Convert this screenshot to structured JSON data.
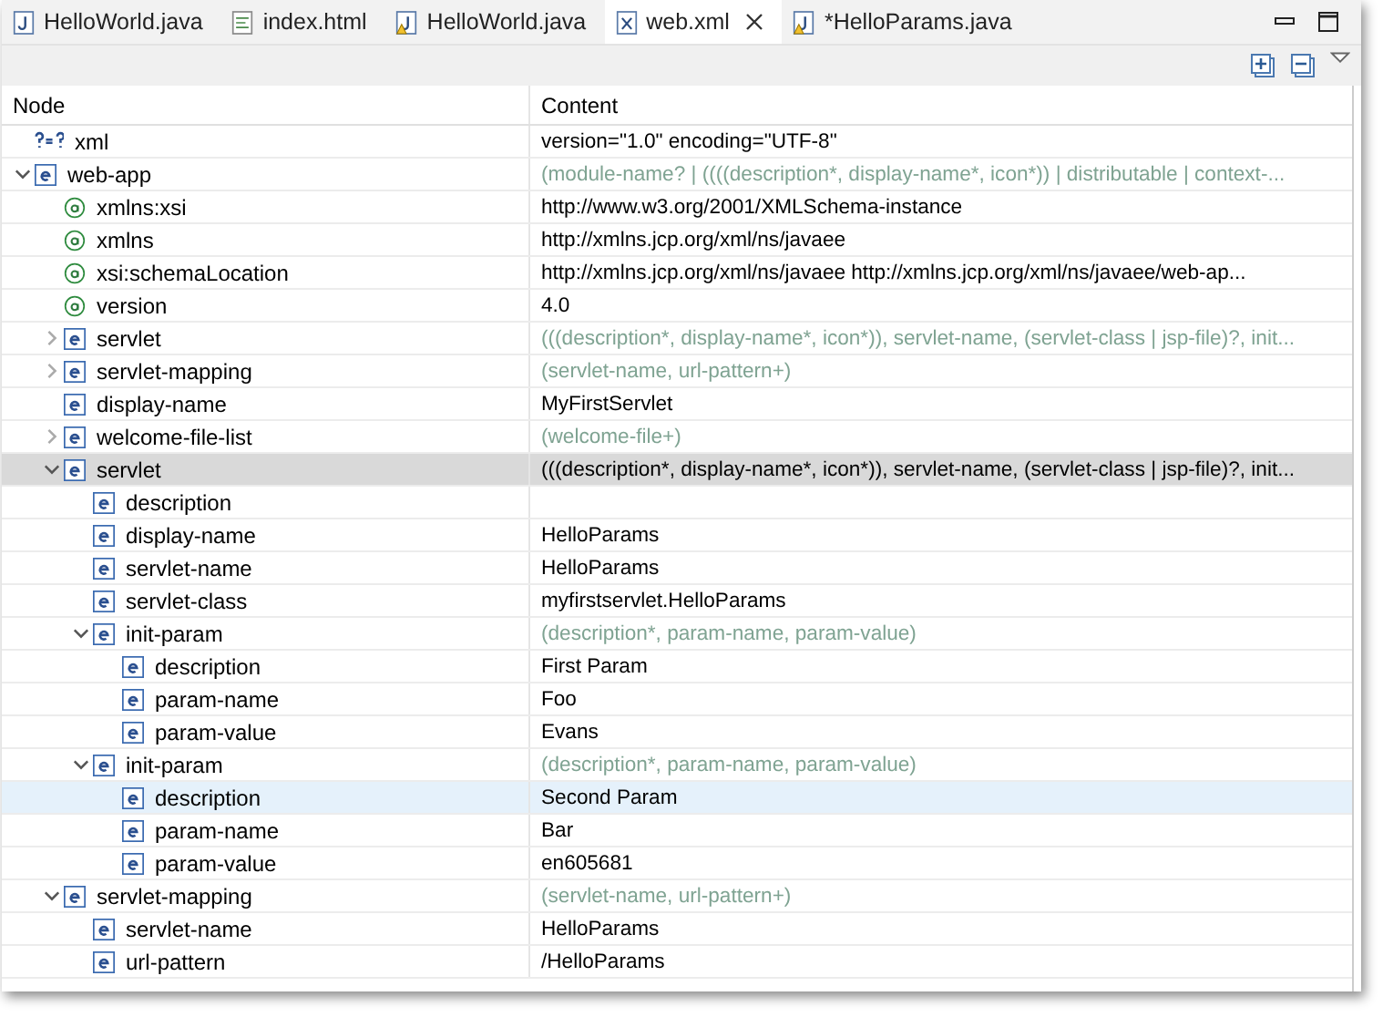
{
  "tabs": [
    {
      "label": "HelloWorld.java",
      "kind": "java",
      "selected": false
    },
    {
      "label": "index.html",
      "kind": "html",
      "selected": false
    },
    {
      "label": "HelloWorld.java",
      "kind": "java-warning",
      "selected": false
    },
    {
      "label": "web.xml",
      "kind": "xml",
      "selected": true
    },
    {
      "label": "*HelloParams.java",
      "kind": "java-warning",
      "selected": false
    }
  ],
  "columns": [
    "Node",
    "Content"
  ],
  "tree": [
    {
      "kind": "pi",
      "name": "xml",
      "content": "version=\"1.0\" encoding=\"UTF-8\"",
      "hint": false,
      "selected": false,
      "hovered": false
    },
    {
      "kind": "element",
      "name": "web-app",
      "content": "(module-name? | ((((description*, display-name*, icon*)) | distributable | context-...",
      "hint": true,
      "expanded": true,
      "selected": false,
      "hovered": false,
      "children": [
        {
          "kind": "attribute",
          "name": "xmlns:xsi",
          "content": "http://www.w3.org/2001/XMLSchema-instance",
          "hint": false,
          "selected": false,
          "hovered": false
        },
        {
          "kind": "attribute",
          "name": "xmlns",
          "content": "http://xmlns.jcp.org/xml/ns/javaee",
          "hint": false,
          "selected": false,
          "hovered": false
        },
        {
          "kind": "attribute",
          "name": "xsi:schemaLocation",
          "content": "http://xmlns.jcp.org/xml/ns/javaee http://xmlns.jcp.org/xml/ns/javaee/web-ap...",
          "hint": false,
          "selected": false,
          "hovered": false
        },
        {
          "kind": "attribute",
          "name": "version",
          "content": "4.0",
          "hint": false,
          "selected": false,
          "hovered": false
        },
        {
          "kind": "element",
          "name": "servlet",
          "content": "(((description*, display-name*, icon*)), servlet-name, (servlet-class | jsp-file)?, init...",
          "hint": true,
          "expanded": false,
          "selected": false,
          "hovered": false
        },
        {
          "kind": "element",
          "name": "servlet-mapping",
          "content": "(servlet-name, url-pattern+)",
          "hint": true,
          "expanded": false,
          "selected": false,
          "hovered": false
        },
        {
          "kind": "element",
          "name": "display-name",
          "content": "MyFirstServlet",
          "hint": false,
          "selected": false,
          "hovered": false
        },
        {
          "kind": "element",
          "name": "welcome-file-list",
          "content": "(welcome-file+)",
          "hint": true,
          "expanded": false,
          "selected": false,
          "hovered": false
        },
        {
          "kind": "element",
          "name": "servlet",
          "content": "(((description*, display-name*, icon*)), servlet-name, (servlet-class | jsp-file)?, init...",
          "hint": false,
          "expanded": true,
          "selected": true,
          "hovered": false,
          "children": [
            {
              "kind": "element",
              "name": "description",
              "selected": false,
              "hovered": false
            },
            {
              "kind": "element",
              "name": "display-name",
              "content": "HelloParams",
              "hint": false,
              "selected": false,
              "hovered": false
            },
            {
              "kind": "element",
              "name": "servlet-name",
              "content": "HelloParams",
              "hint": false,
              "selected": false,
              "hovered": false
            },
            {
              "kind": "element",
              "name": "servlet-class",
              "content": "myfirstservlet.HelloParams",
              "hint": false,
              "selected": false,
              "hovered": false
            },
            {
              "kind": "element",
              "name": "init-param",
              "content": "(description*, param-name, param-value)",
              "hint": true,
              "expanded": true,
              "selected": false,
              "hovered": false,
              "children": [
                {
                  "kind": "element",
                  "name": "description",
                  "content": "First Param",
                  "hint": false,
                  "selected": false,
                  "hovered": false
                },
                {
                  "kind": "element",
                  "name": "param-name",
                  "content": "Foo",
                  "hint": false,
                  "selected": false,
                  "hovered": false
                },
                {
                  "kind": "element",
                  "name": "param-value",
                  "content": "Evans",
                  "hint": false,
                  "selected": false,
                  "hovered": false
                }
              ]
            },
            {
              "kind": "element",
              "name": "init-param",
              "content": "(description*, param-name, param-value)",
              "hint": true,
              "expanded": true,
              "selected": false,
              "hovered": false,
              "children": [
                {
                  "kind": "element",
                  "name": "description",
                  "content": "Second Param",
                  "hint": false,
                  "selected": false,
                  "hovered": true
                },
                {
                  "kind": "element",
                  "name": "param-name",
                  "content": "Bar",
                  "hint": false,
                  "selected": false,
                  "hovered": false
                },
                {
                  "kind": "element",
                  "name": "param-value",
                  "content": "en605681",
                  "hint": false,
                  "selected": false,
                  "hovered": false
                }
              ]
            }
          ]
        },
        {
          "kind": "element",
          "name": "servlet-mapping",
          "content": "(servlet-name, url-pattern+)",
          "hint": true,
          "expanded": true,
          "selected": false,
          "hovered": false,
          "children": [
            {
              "kind": "element",
              "name": "servlet-name",
              "content": "HelloParams",
              "hint": false,
              "selected": false,
              "hovered": false
            },
            {
              "kind": "element",
              "name": "url-pattern",
              "content": "/HelloParams",
              "hint": false,
              "selected": false,
              "hovered": false
            }
          ]
        }
      ]
    }
  ]
}
